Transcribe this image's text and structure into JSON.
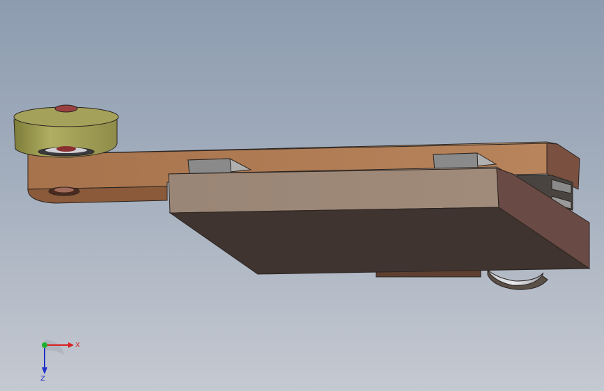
{
  "view": {
    "background_top": "#8d9cb0",
    "background_bottom": "#c5c9d1"
  },
  "model": {
    "arm_color": "#a8744f",
    "housing_top_color": "#9b8574",
    "housing_side_color": "#403430",
    "housing_end_color": "#6a4a44",
    "roller_color": "#a8a65c",
    "rail_block_color": "#8e8e8e"
  },
  "triad": {
    "x_label": "X",
    "z_label": "Z",
    "x_color": "#d82020",
    "y_color": "#20b030",
    "z_color": "#2030c8"
  }
}
